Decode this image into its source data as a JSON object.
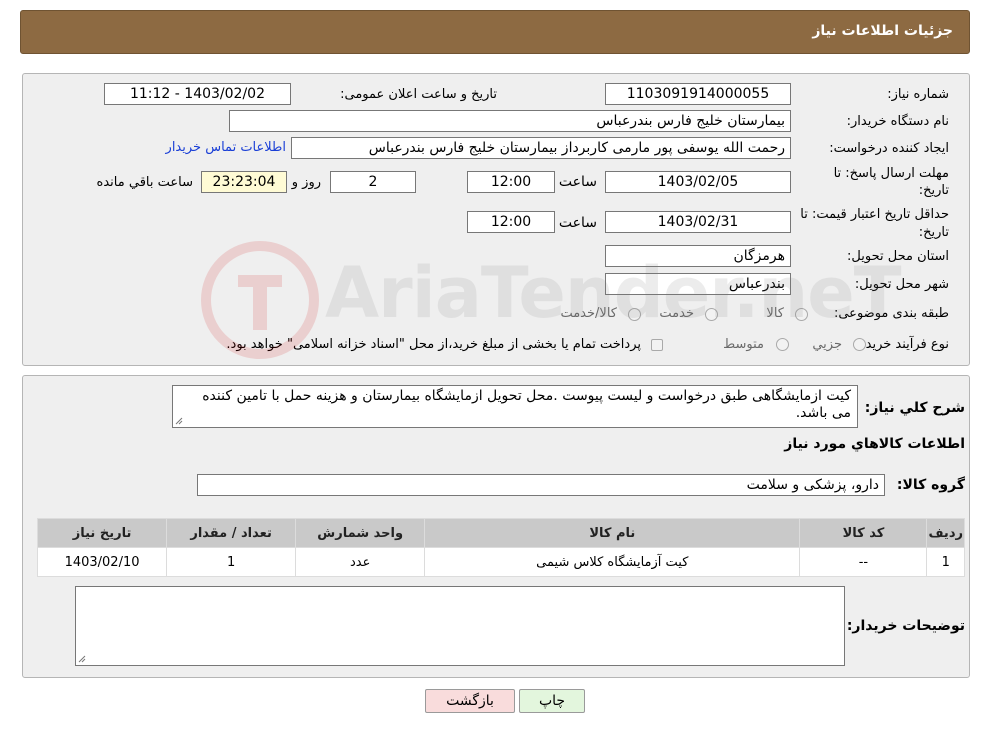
{
  "header": {
    "title": "جزئیات اطلاعات نیاز"
  },
  "form": {
    "need_number_label": "شماره نیاز:",
    "need_number": "1103091914000055",
    "announce_label": "تاریخ و ساعت اعلان عمومی:",
    "announce_value": "1403/02/02 - 11:12",
    "buyer_org_label": "نام دستگاه خریدار:",
    "buyer_org": "بیمارستان خلیج فارس بندرعباس",
    "creator_label": "ایجاد کننده درخواست:",
    "creator": "رحمت الله یوسفی پور مارمی کاربرداز بیمارستان خلیج فارس بندرعباس",
    "contact_link": "اطلاعات تماس خریدار",
    "deadline_label_1": "مهلت ارسال پاسخ: تا",
    "deadline_label_2": "تاریخ:",
    "deadline_date": "1403/02/05",
    "time_label": "ساعت",
    "deadline_time": "12:00",
    "days_value": "2",
    "days_label": "روز و",
    "remaining_time": "23:23:04",
    "remaining_label": "ساعت باقي مانده",
    "price_validity_label_1": "حداقل تاریخ اعتبار قیمت: تا",
    "price_validity_label_2": "تاریخ:",
    "price_validity_date": "1403/02/31",
    "price_validity_time": "12:00",
    "province_label": "استان محل تحویل:",
    "province": "هرمزگان",
    "city_label": "شهر محل تحویل:",
    "city": "بندرعباس",
    "category_label": "طبقه بندی موضوعی:",
    "category_options": [
      "کالا",
      "خدمت",
      "کالا/خدمت"
    ],
    "process_label": "نوع فرآیند خرید :",
    "process_options": [
      "جزيي",
      "متوسط"
    ],
    "process_note": "پرداخت تمام یا بخشی از مبلغ خرید،از محل \"اسناد خزانه اسلامی\" خواهد بود."
  },
  "details": {
    "description_label": "شرح کلي نياز:",
    "description": "کیت ازمایشگاهی طبق  درخواست و لیست پیوست .محل تحویل ازمایشگاه بیمارستان و هزینه حمل با تامین کننده می باشد.",
    "goods_info_title": "اطلاعات کالاهاي مورد نياز",
    "goods_group_label": "گروه کالا:",
    "goods_group": "دارو، پزشکی و سلامت",
    "buyer_notes_label": "توضیحات خریدار:",
    "buyer_notes": ""
  },
  "table": {
    "headers": [
      "رديف",
      "کد کالا",
      "نام کالا",
      "واحد شمارش",
      "تعداد / مقدار",
      "تاریخ نیاز"
    ],
    "rows": [
      [
        "1",
        "--",
        "کیت آزمایشگاه کلاس شیمی",
        "عدد",
        "1",
        "1403/02/10"
      ]
    ]
  },
  "buttons": {
    "print": "چاپ",
    "back": "بازگشت"
  },
  "watermark": "AriaTender.neT",
  "colors": {
    "header": "#8d6a42",
    "link": "#1a3fd6",
    "back_button": "#f9dcdc",
    "print_button": "#e3f6dd"
  }
}
